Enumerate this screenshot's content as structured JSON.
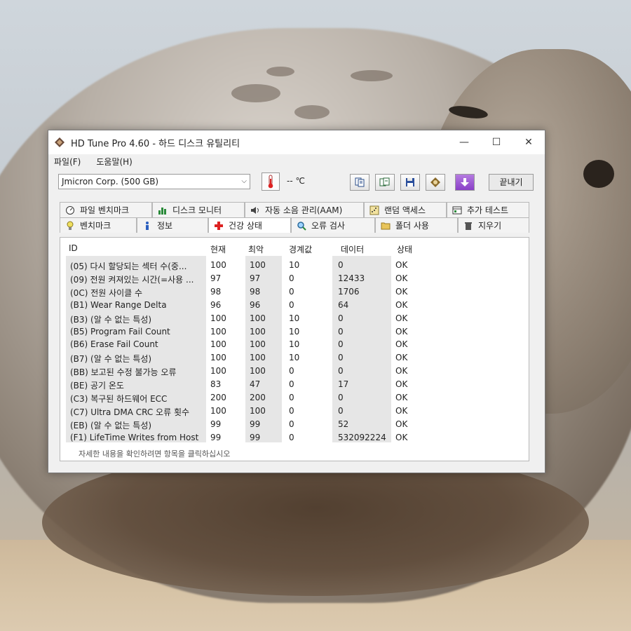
{
  "window": {
    "title": "HD Tune Pro 4.60 - 하드 디스크 유틸리티",
    "minimize": "—",
    "maximize": "☐",
    "close": "✕"
  },
  "menu": [
    "파일(F)",
    "도움말(H)"
  ],
  "toolbar": {
    "drive": "Jmicron Corp. (500 GB)",
    "temperature": "-- ℃",
    "exit_label": "끝내기"
  },
  "tabs_row1": [
    {
      "label": "파일 벤치마크",
      "icon": "file-benchmark-icon"
    },
    {
      "label": "디스크 모니터",
      "icon": "disk-monitor-icon"
    },
    {
      "label": "자동 소음 관리(AAM)",
      "icon": "speaker-icon"
    },
    {
      "label": "랜덤 액세스",
      "icon": "random-access-icon"
    },
    {
      "label": "추가 테스트",
      "icon": "extra-tests-icon"
    }
  ],
  "tabs_row2": [
    {
      "label": "벤치마크",
      "icon": "benchmark-icon"
    },
    {
      "label": "정보",
      "icon": "info-icon"
    },
    {
      "label": "건강 상태",
      "icon": "health-icon"
    },
    {
      "label": "오류 검사",
      "icon": "error-scan-icon"
    },
    {
      "label": "폴더 사용",
      "icon": "folder-icon"
    },
    {
      "label": "지우기",
      "icon": "erase-icon"
    }
  ],
  "active_tab": "건강 상태",
  "table": {
    "headers": [
      "ID",
      "현재",
      "최악",
      "경계값",
      "데이터",
      "상태"
    ],
    "rows": [
      [
        "(05) 다시 할당되는 섹터 수(중...",
        "100",
        "100",
        "10",
        "0",
        "OK"
      ],
      [
        "(09) 전원 켜져있는 시간(=사용 ...",
        "97",
        "97",
        "0",
        "12433",
        "OK"
      ],
      [
        "(0C) 전원 사이클 수",
        "98",
        "98",
        "0",
        "1706",
        "OK"
      ],
      [
        "(B1) Wear Range Delta",
        "96",
        "96",
        "0",
        "64",
        "OK"
      ],
      [
        "(B3) (알 수 없는 특성)",
        "100",
        "100",
        "10",
        "0",
        "OK"
      ],
      [
        "(B5) Program Fail Count",
        "100",
        "100",
        "10",
        "0",
        "OK"
      ],
      [
        "(B6) Erase Fail Count",
        "100",
        "100",
        "10",
        "0",
        "OK"
      ],
      [
        "(B7) (알 수 없는 특성)",
        "100",
        "100",
        "10",
        "0",
        "OK"
      ],
      [
        "(BB) 보고된 수정 불가능 오류",
        "100",
        "100",
        "0",
        "0",
        "OK"
      ],
      [
        "(BE) 공기 온도",
        "83",
        "47",
        "0",
        "17",
        "OK"
      ],
      [
        "(C3) 복구된 하드웨어 ECC",
        "200",
        "200",
        "0",
        "0",
        "OK"
      ],
      [
        "(C7) Ultra DMA CRC 오류 횟수",
        "100",
        "100",
        "0",
        "0",
        "OK"
      ],
      [
        "(EB) (알 수 없는 특성)",
        "99",
        "99",
        "0",
        "52",
        "OK"
      ],
      [
        "(F1) LifeTime Writes from Host",
        "99",
        "99",
        "0",
        "532092224",
        "OK"
      ]
    ]
  },
  "footer_hint": "자세한 내용을 확인하려면 항목을 클릭하십시오"
}
